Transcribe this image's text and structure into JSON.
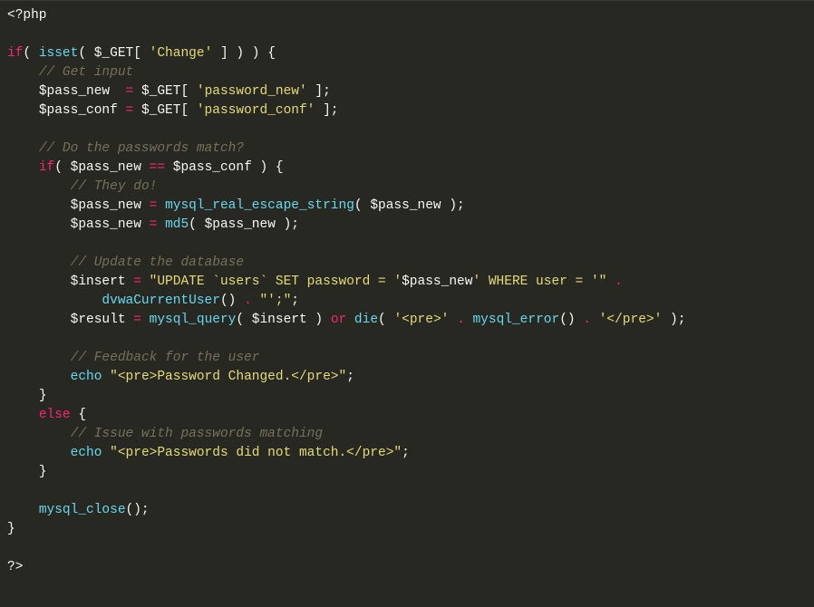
{
  "code": {
    "language": "php",
    "lines": [
      {
        "indent": 0,
        "tokens": [
          [
            "tag",
            "<?php"
          ]
        ]
      },
      {
        "indent": 0,
        "tokens": []
      },
      {
        "indent": 0,
        "tokens": [
          [
            "k",
            "if"
          ],
          [
            "p",
            "( "
          ],
          [
            "f",
            "isset"
          ],
          [
            "p",
            "( "
          ],
          [
            "v",
            "$_GET"
          ],
          [
            "p",
            "[ "
          ],
          [
            "s",
            "'Change'"
          ],
          [
            "p",
            " ] ) ) {"
          ]
        ]
      },
      {
        "indent": 1,
        "tokens": [
          [
            "c",
            "// Get input"
          ]
        ]
      },
      {
        "indent": 1,
        "tokens": [
          [
            "v",
            "$pass_new"
          ],
          [
            "p",
            "  "
          ],
          [
            "op",
            "="
          ],
          [
            "p",
            " "
          ],
          [
            "v",
            "$_GET"
          ],
          [
            "p",
            "[ "
          ],
          [
            "s",
            "'password_new'"
          ],
          [
            "p",
            " ];"
          ]
        ]
      },
      {
        "indent": 1,
        "tokens": [
          [
            "v",
            "$pass_conf"
          ],
          [
            "p",
            " "
          ],
          [
            "op",
            "="
          ],
          [
            "p",
            " "
          ],
          [
            "v",
            "$_GET"
          ],
          [
            "p",
            "[ "
          ],
          [
            "s",
            "'password_conf'"
          ],
          [
            "p",
            " ];"
          ]
        ]
      },
      {
        "indent": 0,
        "tokens": []
      },
      {
        "indent": 1,
        "tokens": [
          [
            "c",
            "// Do the passwords match?"
          ]
        ]
      },
      {
        "indent": 1,
        "tokens": [
          [
            "k",
            "if"
          ],
          [
            "p",
            "( "
          ],
          [
            "v",
            "$pass_new"
          ],
          [
            "p",
            " "
          ],
          [
            "op",
            "=="
          ],
          [
            "p",
            " "
          ],
          [
            "v",
            "$pass_conf"
          ],
          [
            "p",
            " ) {"
          ]
        ]
      },
      {
        "indent": 2,
        "tokens": [
          [
            "c",
            "// They do!"
          ]
        ]
      },
      {
        "indent": 2,
        "tokens": [
          [
            "v",
            "$pass_new"
          ],
          [
            "p",
            " "
          ],
          [
            "op",
            "="
          ],
          [
            "p",
            " "
          ],
          [
            "f",
            "mysql_real_escape_string"
          ],
          [
            "p",
            "( "
          ],
          [
            "v",
            "$pass_new"
          ],
          [
            "p",
            " );"
          ]
        ]
      },
      {
        "indent": 2,
        "tokens": [
          [
            "v",
            "$pass_new"
          ],
          [
            "p",
            " "
          ],
          [
            "op",
            "="
          ],
          [
            "p",
            " "
          ],
          [
            "f",
            "md5"
          ],
          [
            "p",
            "( "
          ],
          [
            "v",
            "$pass_new"
          ],
          [
            "p",
            " );"
          ]
        ]
      },
      {
        "indent": 0,
        "tokens": []
      },
      {
        "indent": 2,
        "tokens": [
          [
            "c",
            "// Update the database"
          ]
        ]
      },
      {
        "indent": 2,
        "tokens": [
          [
            "v",
            "$insert"
          ],
          [
            "p",
            " "
          ],
          [
            "op",
            "="
          ],
          [
            "p",
            " "
          ],
          [
            "s",
            "\"UPDATE `users` SET password = '"
          ],
          [
            "v",
            "$pass_new"
          ],
          [
            "s",
            "' WHERE user = '\""
          ],
          [
            "p",
            " "
          ],
          [
            "op",
            "."
          ],
          [
            "p",
            " "
          ]
        ]
      },
      {
        "indent": 3,
        "tokens": [
          [
            "f",
            "dvwaCurrentUser"
          ],
          [
            "p",
            "() "
          ],
          [
            "op",
            "."
          ],
          [
            "p",
            " "
          ],
          [
            "s",
            "\"';\""
          ],
          [
            "p",
            ";"
          ]
        ]
      },
      {
        "indent": 2,
        "tokens": [
          [
            "v",
            "$result"
          ],
          [
            "p",
            " "
          ],
          [
            "op",
            "="
          ],
          [
            "p",
            " "
          ],
          [
            "f",
            "mysql_query"
          ],
          [
            "p",
            "( "
          ],
          [
            "v",
            "$insert"
          ],
          [
            "p",
            " ) "
          ],
          [
            "k",
            "or"
          ],
          [
            "p",
            " "
          ],
          [
            "f",
            "die"
          ],
          [
            "p",
            "( "
          ],
          [
            "s",
            "'<pre>'"
          ],
          [
            "p",
            " "
          ],
          [
            "op",
            "."
          ],
          [
            "p",
            " "
          ],
          [
            "f",
            "mysql_error"
          ],
          [
            "p",
            "() "
          ],
          [
            "op",
            "."
          ],
          [
            "p",
            " "
          ],
          [
            "s",
            "'</pre>'"
          ],
          [
            "p",
            " );"
          ]
        ]
      },
      {
        "indent": 0,
        "tokens": []
      },
      {
        "indent": 2,
        "tokens": [
          [
            "c",
            "// Feedback for the user"
          ]
        ]
      },
      {
        "indent": 2,
        "tokens": [
          [
            "f",
            "echo"
          ],
          [
            "p",
            " "
          ],
          [
            "s",
            "\"<pre>Password Changed.</pre>\""
          ],
          [
            "p",
            ";"
          ]
        ]
      },
      {
        "indent": 1,
        "tokens": [
          [
            "p",
            "}"
          ]
        ]
      },
      {
        "indent": 1,
        "tokens": [
          [
            "k",
            "else"
          ],
          [
            "p",
            " {"
          ]
        ]
      },
      {
        "indent": 2,
        "tokens": [
          [
            "c",
            "// Issue with passwords matching"
          ]
        ]
      },
      {
        "indent": 2,
        "tokens": [
          [
            "f",
            "echo"
          ],
          [
            "p",
            " "
          ],
          [
            "s",
            "\"<pre>Passwords did not match.</pre>\""
          ],
          [
            "p",
            ";"
          ]
        ]
      },
      {
        "indent": 1,
        "tokens": [
          [
            "p",
            "}"
          ]
        ]
      },
      {
        "indent": 0,
        "tokens": []
      },
      {
        "indent": 1,
        "tokens": [
          [
            "f",
            "mysql_close"
          ],
          [
            "p",
            "();"
          ]
        ]
      },
      {
        "indent": 0,
        "tokens": [
          [
            "p",
            "}"
          ]
        ]
      },
      {
        "indent": 0,
        "tokens": []
      },
      {
        "indent": 0,
        "tokens": [
          [
            "tag",
            "?>"
          ]
        ]
      }
    ]
  }
}
